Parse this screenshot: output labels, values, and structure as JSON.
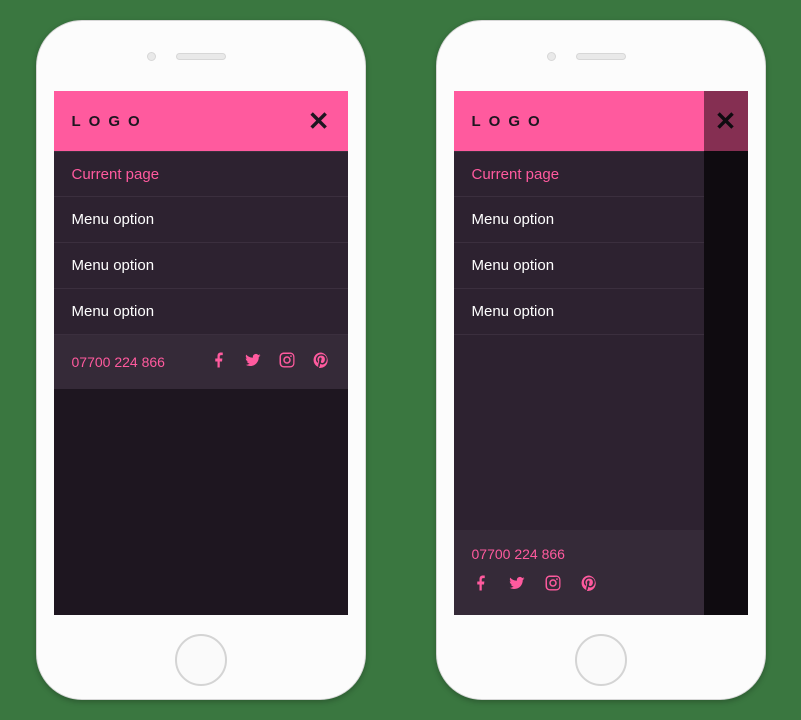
{
  "logo_text": "LOGO",
  "close_glyph": "✕",
  "menu": {
    "current_label": "Current page",
    "option_label": "Menu option"
  },
  "contact": {
    "phone": "07700 224 866"
  },
  "social": {
    "facebook": "facebook-icon",
    "twitter": "twitter-icon",
    "instagram": "instagram-icon",
    "pinterest": "pinterest-icon"
  }
}
